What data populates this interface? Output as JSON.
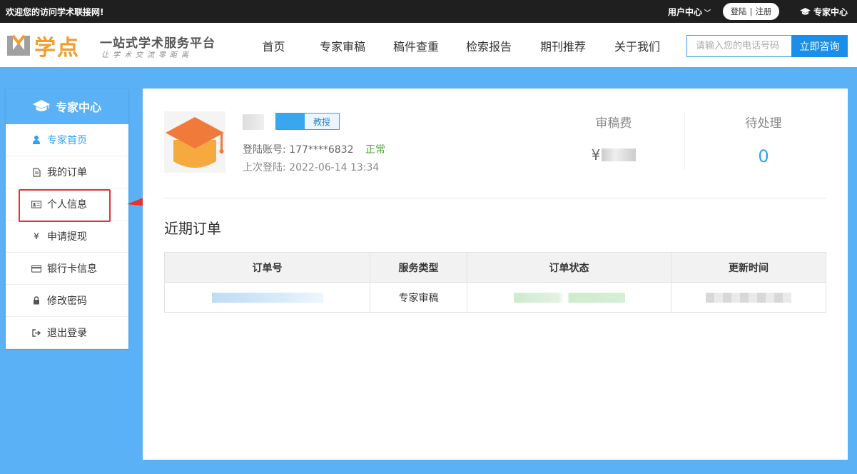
{
  "topbar": {
    "welcome": "欢迎您的访问学术联接网!",
    "user_center": "用户中心",
    "login": "登陆",
    "separator": "|",
    "register": "注册",
    "expert_center": "专家中心"
  },
  "header": {
    "brand": "学点",
    "slogan": "一站式学术服务平台",
    "slogan2": "让学术交流零距离",
    "nav": [
      "首页",
      "专家审稿",
      "稿件查重",
      "检索报告",
      "期刊推荐",
      "关于我们"
    ],
    "phone_placeholder": "请输入您的电话号码",
    "consult_button": "立即咨询"
  },
  "sidebar": {
    "title": "专家中心",
    "items": [
      {
        "label": "专家首页",
        "icon": "user-icon",
        "active": true
      },
      {
        "label": "我的订单",
        "icon": "document-icon"
      },
      {
        "label": "个人信息",
        "icon": "id-card-icon"
      },
      {
        "label": "申请提现",
        "icon": "yuan-icon"
      },
      {
        "label": "银行卡信息",
        "icon": "bank-card-icon"
      },
      {
        "label": "修改密码",
        "icon": "lock-icon"
      },
      {
        "label": "退出登录",
        "icon": "logout-icon"
      }
    ]
  },
  "profile": {
    "title_badge": "教授",
    "account_label": "登陆账号:",
    "account": "177****6832",
    "status": "正常",
    "last_login_label": "上次登陆:",
    "last_login": "2022-06-14 13:34"
  },
  "stats": {
    "fee_label": "审稿费",
    "fee_prefix": "¥",
    "pending_label": "待处理",
    "pending_value": "0"
  },
  "orders": {
    "title": "近期订单",
    "columns": [
      "订单号",
      "服务类型",
      "订单状态",
      "更新时间"
    ],
    "rows": [
      {
        "service_type": "专家审稿"
      }
    ]
  },
  "colors": {
    "accent": "#2ea3ee",
    "page_bg": "#5ab1f5",
    "highlight": "#e8312a",
    "brand_orange": "#f29b2e"
  }
}
